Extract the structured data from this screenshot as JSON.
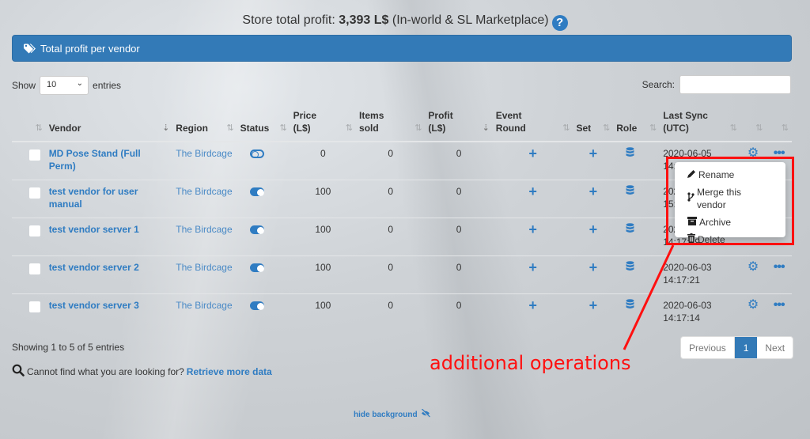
{
  "header": {
    "total_prefix": "Store total profit: ",
    "total_value": "3,393 L$",
    "total_suffix": " (In-world & SL Marketplace)",
    "help_icon": "question-circle-icon"
  },
  "panel": {
    "title": "Total profit per vendor",
    "icon": "tags-icon"
  },
  "length": {
    "show_label": "Show",
    "selected": "10",
    "entries_label": "entries"
  },
  "search": {
    "label": "Search:",
    "value": "",
    "placeholder": ""
  },
  "table": {
    "columns": [
      {
        "label": ""
      },
      {
        "label": "Vendor"
      },
      {
        "label": "Region"
      },
      {
        "label": "Status"
      },
      {
        "label": "Price (L$)"
      },
      {
        "label": "Items sold"
      },
      {
        "label": "Profit (L$)"
      },
      {
        "label": "Event Round"
      },
      {
        "label": "Set"
      },
      {
        "label": "Role"
      },
      {
        "label": "Last Sync (UTC)"
      },
      {
        "label": ""
      },
      {
        "label": ""
      }
    ],
    "rows": [
      {
        "vendor": "MD Pose Stand (Full Perm)",
        "region": "The Birdcage",
        "status": "off",
        "price": "0",
        "items_sold": "0",
        "profit": "0",
        "sync_date": "2020-06-05",
        "sync_time": "14:2"
      },
      {
        "vendor": "test vendor for user manual",
        "region": "The Birdcage",
        "status": "on",
        "price": "100",
        "items_sold": "0",
        "profit": "0",
        "sync_date": "2020",
        "sync_time": "15:3"
      },
      {
        "vendor": "test vendor server 1",
        "region": "The Birdcage",
        "status": "on",
        "price": "100",
        "items_sold": "0",
        "profit": "0",
        "sync_date": "2020",
        "sync_time": "14:17:19"
      },
      {
        "vendor": "test vendor server 2",
        "region": "The Birdcage",
        "status": "on",
        "price": "100",
        "items_sold": "0",
        "profit": "0",
        "sync_date": "2020-06-03",
        "sync_time": "14:17:21"
      },
      {
        "vendor": "test vendor server 3",
        "region": "The Birdcage",
        "status": "on",
        "price": "100",
        "items_sold": "0",
        "profit": "0",
        "sync_date": "2020-06-03",
        "sync_time": "14:17:14"
      }
    ]
  },
  "dropdown_menu": {
    "items": [
      {
        "label": "Rename",
        "icon": "pencil-icon"
      },
      {
        "label": "Merge this vendor",
        "icon": "code-branch-icon"
      },
      {
        "label": "Archive",
        "icon": "archive-icon"
      },
      {
        "label": "Delete",
        "icon": "trash-icon"
      }
    ]
  },
  "footer": {
    "info": "Showing 1 to 5 of 5 entries",
    "cannot_find": "Cannot find what you are looking for?",
    "retrieve_link": "Retrieve more data",
    "pagination": {
      "previous": "Previous",
      "current": "1",
      "next": "Next"
    },
    "hide_background": "hide background"
  },
  "annotation": {
    "text": "additional operations",
    "color": "#ff1010"
  },
  "colors": {
    "primary": "#337ab7",
    "link": "#2f7cc2",
    "annotation_red": "#ff1010"
  }
}
